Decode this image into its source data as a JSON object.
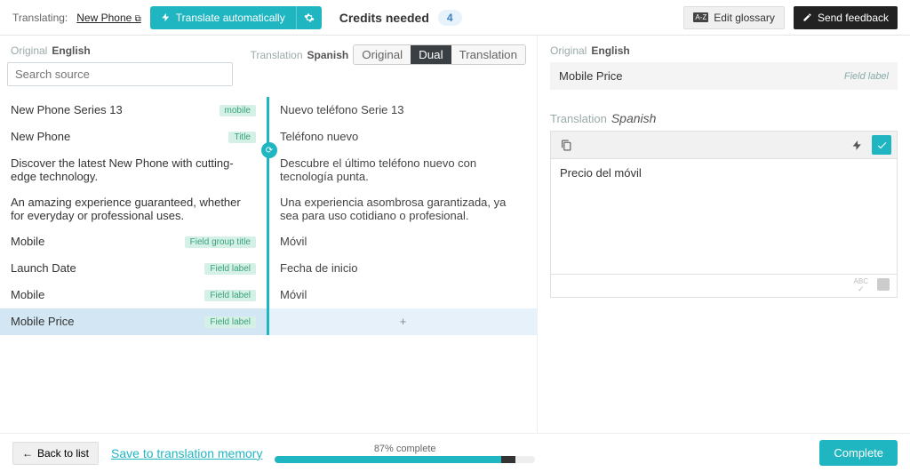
{
  "topbar": {
    "translating_label": "Translating:",
    "project_name": "New Phone",
    "translate_auto": "Translate automatically",
    "credits_label": "Credits needed",
    "credits_value": "4",
    "edit_glossary": "Edit glossary",
    "send_feedback": "Send feedback"
  },
  "columns": {
    "original_label": "Original",
    "original_lang": "English",
    "translation_label": "Translation",
    "translation_lang": "Spanish",
    "search_placeholder": "Search source"
  },
  "view_toggle": {
    "original": "Original",
    "dual": "Dual",
    "translation": "Translation",
    "active": "dual"
  },
  "rows": [
    {
      "source": "New Phone Series 13",
      "target": "Nuevo teléfono Serie 13",
      "tag": "mobile"
    },
    {
      "source": "New Phone",
      "target": "Teléfono nuevo",
      "tag": "Title"
    },
    {
      "source": "Discover the latest New Phone with cutting-edge technology.",
      "target": "Descubre el último teléfono nuevo con tecnología punta.",
      "tag": "",
      "sync": true
    },
    {
      "source": "An amazing experience guaranteed, whether for everyday or professional uses.",
      "target": "Una experiencia asombrosa garantizada, ya sea para uso cotidiano o profesional.",
      "tag": ""
    },
    {
      "source": "Mobile",
      "target": "Móvil",
      "tag": "Field group title"
    },
    {
      "source": "Launch Date",
      "target": "Fecha de inicio",
      "tag": "Field label"
    },
    {
      "source": "Mobile",
      "target": "Móvil",
      "tag": "Field label"
    },
    {
      "source": "Mobile Price",
      "target": "",
      "tag": "Field label",
      "selected": true,
      "empty": true
    }
  ],
  "right": {
    "original_label": "Original",
    "original_lang": "English",
    "original_text": "Mobile Price",
    "field_label_tag": "Field label",
    "translation_label": "Translation",
    "translation_lang": "Spanish",
    "editor_text": "Precio del móvil",
    "abc_label": "ABC"
  },
  "footer": {
    "back": "Back to list",
    "save": "Save to translation memory",
    "progress_label": "87% complete",
    "progress_pct": 87,
    "complete": "Complete"
  }
}
